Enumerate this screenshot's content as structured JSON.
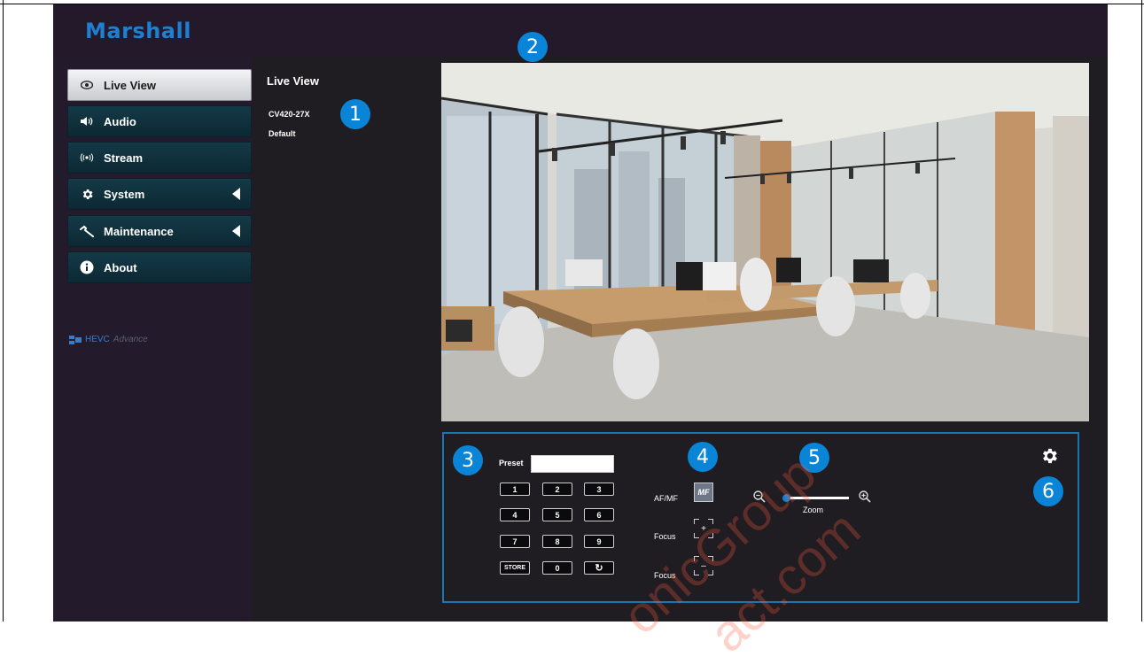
{
  "brand": {
    "logo": "Marshall"
  },
  "sidebar": {
    "items": [
      {
        "label": "Live View",
        "icon": "eye-icon",
        "active": true,
        "submenu": false
      },
      {
        "label": "Audio",
        "icon": "speaker-icon",
        "active": false,
        "submenu": false
      },
      {
        "label": "Stream",
        "icon": "broadcast-icon",
        "active": false,
        "submenu": false
      },
      {
        "label": "System",
        "icon": "gear-icon",
        "active": false,
        "submenu": true
      },
      {
        "label": "Maintenance",
        "icon": "wrench-icon",
        "active": false,
        "submenu": true
      },
      {
        "label": "About",
        "icon": "info-icon",
        "active": false,
        "submenu": false
      }
    ],
    "hevc": {
      "main": "HEVC",
      "sub": "Advance"
    }
  },
  "content": {
    "title": "Live View",
    "model": "CV420-27X",
    "profile": "Default"
  },
  "badges": [
    "1",
    "2",
    "3",
    "4",
    "5",
    "6"
  ],
  "controls": {
    "preset_label": "Preset",
    "preset_value": "",
    "keys": [
      "1",
      "2",
      "3",
      "4",
      "5",
      "6",
      "7",
      "8",
      "9",
      "STORE",
      "0",
      "↻"
    ],
    "afmf_label": "AF/MF",
    "mf_button": "MF",
    "focus_near_label": "Focus",
    "focus_far_label": "Focus",
    "zoom_label": "Zoom",
    "zoom_level": 0
  },
  "watermark": {
    "line1": "onicGroup",
    "line2": "act.com"
  },
  "colors": {
    "accent": "#0a84d6",
    "panel_border": "#1976b5",
    "logo": "#1f7fd0",
    "background": "#1f1d22"
  }
}
